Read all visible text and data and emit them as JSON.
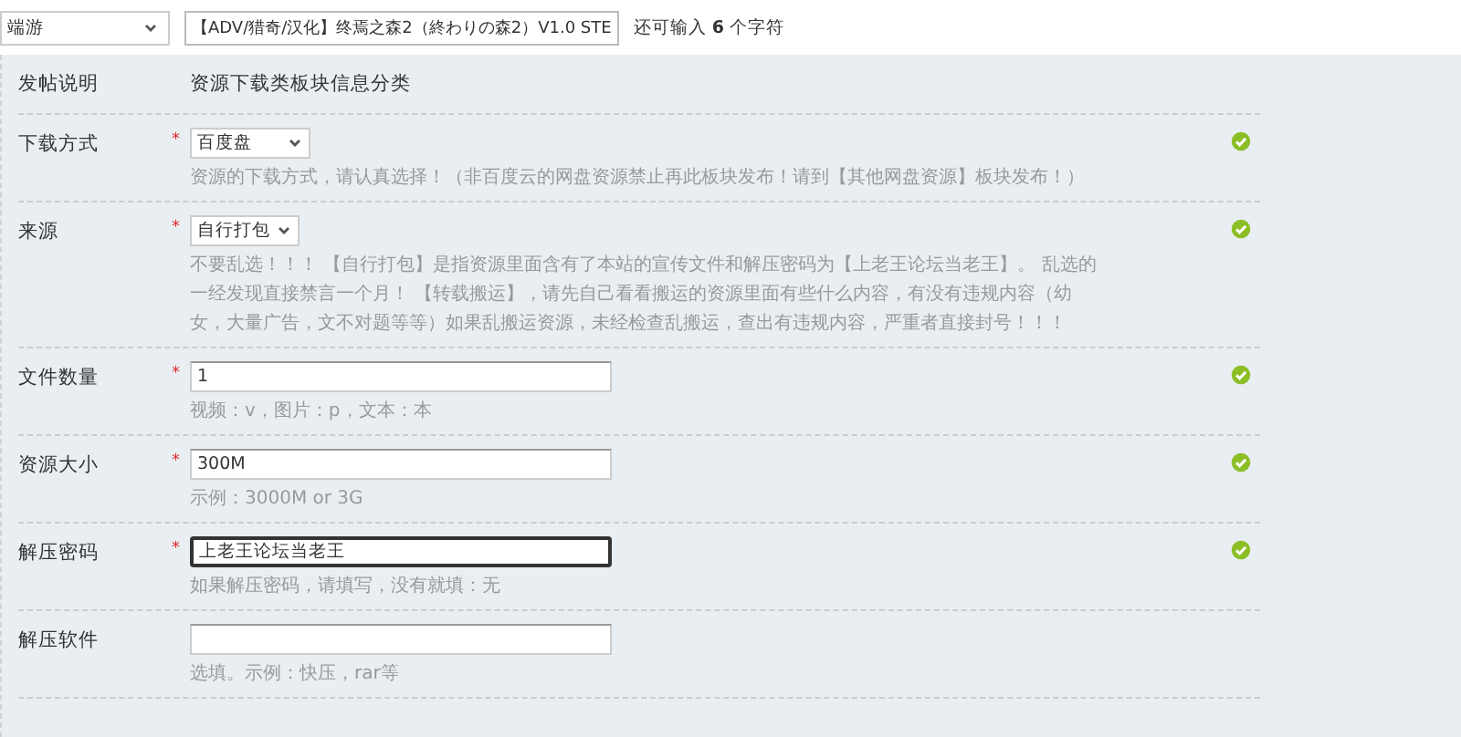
{
  "top_bar": {
    "category": {
      "value": "端游"
    },
    "title_field": {
      "value": "【ADV/猎奇/汉化】终焉之森2（終わりの森2）V1.0 STE"
    },
    "counter": "还可输入 **6** 个字符"
  },
  "form": {
    "header": {
      "label": "发帖说明",
      "value": "资源下载类板块信息分类"
    },
    "fields": [
      {
        "label": "下载方式",
        "kind": "select",
        "marker": "*",
        "value": "百度盘",
        "valid": true,
        "hint": "资源的下载方式，请认真选择！（非百度云的网盘资源禁止再此板块发布！请到【其他网盘资源】板块发布！）"
      },
      {
        "label": "来源",
        "kind": "select",
        "marker": "*",
        "value": "自行打包",
        "valid": true,
        "hint": "不要乱选！！！ 【自行打包】是指资源里面含有了本站的宣传文件和解压密码为【上老王论坛当老王】。 乱选的一经发现直接禁言一个月！ 【转载搬运】，请先自己看看搬运的资源里面有些什么内容，有没有违规内容（幼女，大量广告，文不对题等等）如果乱搬运资源，未经检查乱搬运，查出有违规内容，严重者直接封号！！！"
      },
      {
        "label": "文件数量",
        "kind": "text",
        "marker": "*",
        "value": "1",
        "focused": false,
        "valid": true,
        "hint": "视频：v，图片：p，文本：本"
      },
      {
        "label": "资源大小",
        "kind": "text",
        "marker": "*",
        "value": "300M",
        "focused": false,
        "valid": true,
        "hint": "示例：3000M or 3G"
      },
      {
        "label": "解压密码",
        "kind": "text",
        "marker": "*",
        "value": "上老王论坛当老王",
        "focused": true,
        "valid": true,
        "hint": "如果解压密码，请填写，没有就填：无"
      },
      {
        "label": "解压软件",
        "kind": "text",
        "focused": false,
        "valid": false,
        "hint": "选填。示例：快压，rar等"
      }
    ]
  }
}
